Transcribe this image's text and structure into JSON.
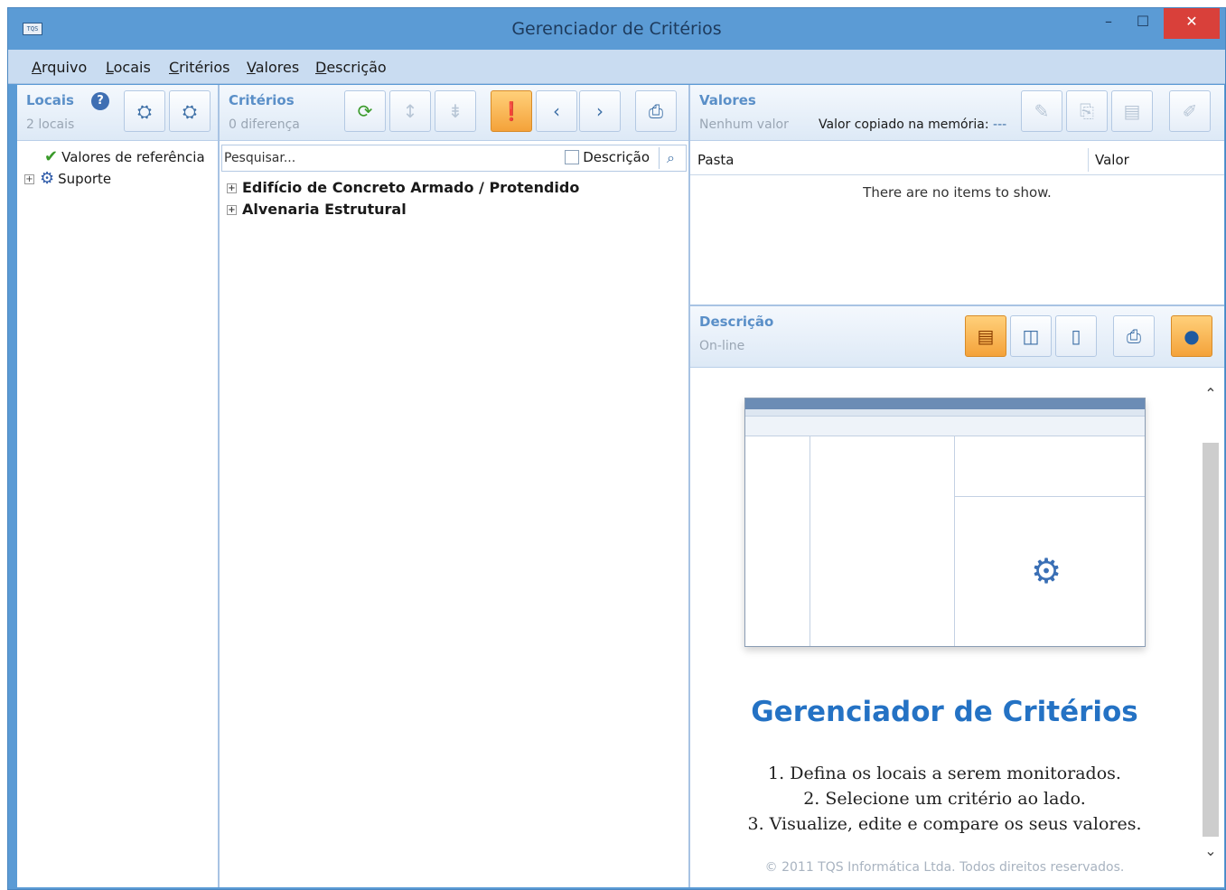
{
  "window": {
    "title": "Gerenciador de Critérios",
    "app_icon_text": "TQS",
    "min_glyph": "–",
    "max_glyph": "☐",
    "close_glyph": "✕"
  },
  "menu": {
    "items": [
      {
        "first": "A",
        "rest": "rquivo"
      },
      {
        "first": "L",
        "rest": "ocais"
      },
      {
        "first": "C",
        "rest": "ritérios"
      },
      {
        "first": "V",
        "rest": "alores"
      },
      {
        "first": "D",
        "rest": "escrição"
      }
    ]
  },
  "locais": {
    "title": "Locais",
    "subtitle": "2 locais",
    "help_glyph": "?",
    "tree": [
      {
        "label": "Valores de referência",
        "icon": "check-icon",
        "glyph": "✔"
      },
      {
        "label": "Suporte",
        "icon": "gear-icon",
        "glyph": "⚙"
      }
    ]
  },
  "criterios": {
    "title": "Critérios",
    "subtitle": "0 diferença",
    "search_placeholder": "Pesquisar...",
    "search_checkbox_label": "Descrição",
    "tree": [
      {
        "label": "Edifício de Concreto Armado / Protendido"
      },
      {
        "label": "Alvenaria Estrutural"
      }
    ]
  },
  "valores": {
    "title": "Valores",
    "subtitle": "Nenhum valor",
    "memory_label": "Valor copiado na memória:",
    "memory_value": "---",
    "columns": [
      "Pasta",
      "Valor"
    ],
    "empty_message": "There are no items to show."
  },
  "descricao": {
    "title": "Descrição",
    "subtitle": "On-line",
    "heading": "Gerenciador de Critérios",
    "steps": [
      "1. Defina os locais a serem monitorados.",
      "2. Selecione um critério ao lado.",
      "3. Visualize, edite e compare os seus valores."
    ],
    "copyright": "© 2011 TQS Informática Ltda. Todos direitos reservados."
  },
  "colors": {
    "title_bar": "#5b9bd5",
    "close_button": "#d9403a",
    "accent_active": "#f4a23a",
    "heading_blue": "#2472c4"
  }
}
